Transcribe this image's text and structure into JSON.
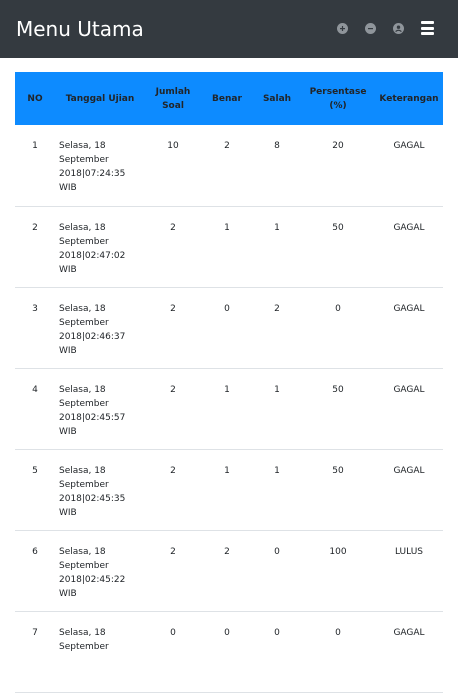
{
  "navbar": {
    "brand": "Menu Utama",
    "icons": [
      "plus-circle-icon",
      "minus-circle-icon",
      "user-circle-icon",
      "hamburger-menu-icon"
    ]
  },
  "table": {
    "headers": [
      "NO",
      "Tanggal Ujian",
      "Jumlah Soal",
      "Benar",
      "Salah",
      "Persentase (%)",
      "Keterangan"
    ],
    "rows": [
      {
        "no": "1",
        "date": "Selasa, 18 September 2018|07:24:35 WIB",
        "total": "10",
        "correct": "2",
        "wrong": "8",
        "percent": "20",
        "status": "GAGAL"
      },
      {
        "no": "2",
        "date": "Selasa, 18 September 2018|02:47:02 WIB",
        "total": "2",
        "correct": "1",
        "wrong": "1",
        "percent": "50",
        "status": "GAGAL"
      },
      {
        "no": "3",
        "date": "Selasa, 18 September 2018|02:46:37 WIB",
        "total": "2",
        "correct": "0",
        "wrong": "2",
        "percent": "0",
        "status": "GAGAL"
      },
      {
        "no": "4",
        "date": "Selasa, 18 September 2018|02:45:57 WIB",
        "total": "2",
        "correct": "1",
        "wrong": "1",
        "percent": "50",
        "status": "GAGAL"
      },
      {
        "no": "5",
        "date": "Selasa, 18 September 2018|02:45:35 WIB",
        "total": "2",
        "correct": "1",
        "wrong": "1",
        "percent": "50",
        "status": "GAGAL"
      },
      {
        "no": "6",
        "date": "Selasa, 18 September 2018|02:45:22 WIB",
        "total": "2",
        "correct": "2",
        "wrong": "0",
        "percent": "100",
        "status": "LULUS"
      },
      {
        "no": "7",
        "date": "Selasa, 18 September",
        "total": "0",
        "correct": "0",
        "wrong": "0",
        "percent": "0",
        "status": "GAGAL"
      }
    ]
  },
  "colors": {
    "navbar": "#343a40",
    "header": "#0d8bff",
    "icon": "#8f959b"
  }
}
